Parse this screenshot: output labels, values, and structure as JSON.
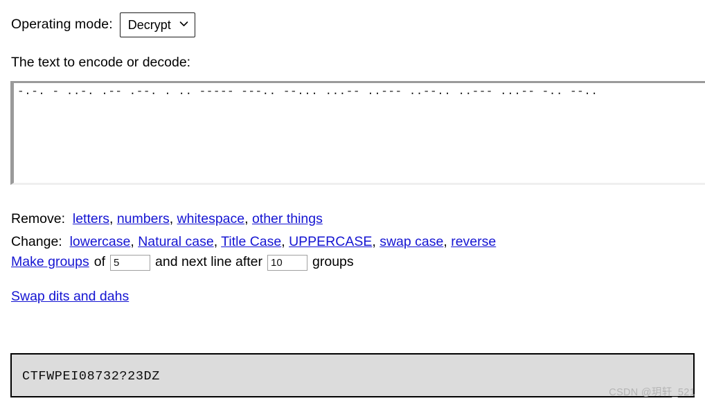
{
  "mode_row": {
    "label": "Operating mode:",
    "select_value": "Decrypt",
    "caret_icon": "chevron-down-icon"
  },
  "textarea_section": {
    "label": "The text to encode or decode:",
    "value": "-.-. - ..-. .-- .--. . .. ----- ---.. --... ...-- ..--- ..--.. ..--- ...-- -.. --.."
  },
  "remove_row": {
    "prefix": "Remove:",
    "links": [
      {
        "label": "letters"
      },
      {
        "label": "numbers"
      },
      {
        "label": "whitespace"
      },
      {
        "label": "other things"
      }
    ],
    "separator": ", "
  },
  "change_row": {
    "prefix": "Change:",
    "links": [
      {
        "label": "lowercase"
      },
      {
        "label": "Natural case"
      },
      {
        "label": "Title Case"
      },
      {
        "label": "UPPERCASE"
      },
      {
        "label": "swap case"
      },
      {
        "label": "reverse"
      }
    ],
    "separator": ", "
  },
  "groups_row": {
    "make_groups_link": "Make groups",
    "of_text": "of",
    "group_size_value": "5",
    "mid_text": "and next line after",
    "line_after_value": "10",
    "suffix_text": "groups"
  },
  "swap_row": {
    "link": "Swap dits and dahs"
  },
  "result": {
    "text": "CTFWPEI08732?23DZ"
  },
  "watermark": {
    "text": "CSDN @玥轩_521"
  },
  "colors": {
    "link": "#1414d2",
    "result_bg": "#dcdcdc",
    "result_border": "#000000",
    "textarea_border": "#9a9a9a",
    "watermark": "#b4b4b4"
  }
}
